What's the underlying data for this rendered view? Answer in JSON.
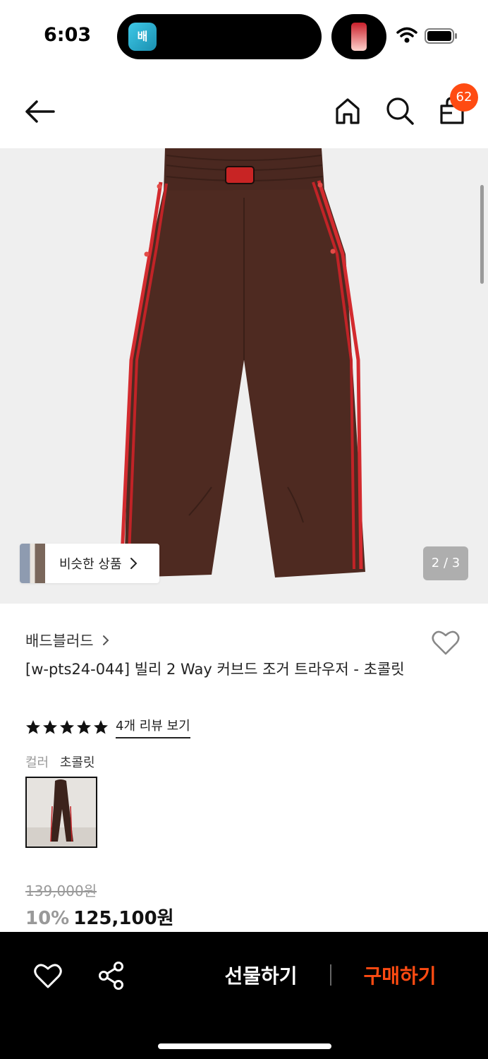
{
  "status": {
    "time": "6:03",
    "island_app_glyph": "배"
  },
  "nav": {
    "cart_count": "62"
  },
  "gallery": {
    "similar_label": "비슷한 상품",
    "page_indicator": "2 / 3"
  },
  "product": {
    "brand": "배드블러드",
    "title": "[w-pts24-044] 빌리 2 Way 커브드 조거 트라우저 - 초콜릿",
    "rating": 5,
    "review_link": "4개 리뷰 보기",
    "option_label": "컬러",
    "option_value": "초콜릿",
    "original_price": "139,000원",
    "discount": "10%",
    "sale_price": "125,100원"
  },
  "bottom_bar": {
    "gift_label": "선물하기",
    "buy_label": "구매하기"
  },
  "colors": {
    "accent": "#ff4b12",
    "pants": "#4e2a21",
    "stripe": "#d32b2f"
  },
  "icons": [
    "back-arrow-icon",
    "home-icon",
    "search-icon",
    "shopping-bag-icon",
    "heart-icon",
    "share-icon",
    "chevron-right-icon",
    "star-icon",
    "wifi-icon",
    "battery-icon"
  ]
}
